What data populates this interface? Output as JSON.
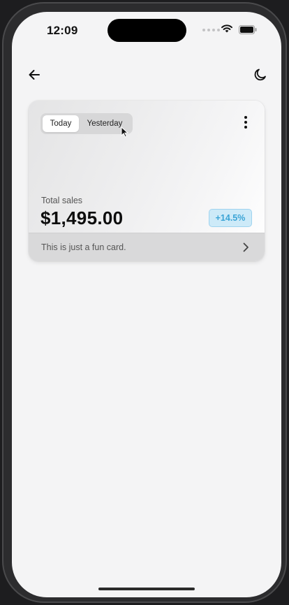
{
  "status_bar": {
    "time": "12:09",
    "icons": [
      "signal-icon",
      "wifi-icon",
      "battery-icon"
    ]
  },
  "header": {
    "back_icon": "arrow-left-icon",
    "theme_icon": "moon-icon"
  },
  "card": {
    "segments": [
      {
        "label": "Today",
        "active": true
      },
      {
        "label": "Yesterday",
        "active": false
      }
    ],
    "menu_icon": "more-vertical-icon",
    "metric_label": "Total sales",
    "metric_value": "$1,495.00",
    "change_badge": "+14.5%",
    "footer_text": "This is just a fun card.",
    "footer_icon": "chevron-right-icon"
  },
  "colors": {
    "screen_bg": "#f4f4f5",
    "badge_bg": "#cdeaf8",
    "badge_text": "#3aa4d6",
    "footer_bg": "#d9d9da"
  }
}
